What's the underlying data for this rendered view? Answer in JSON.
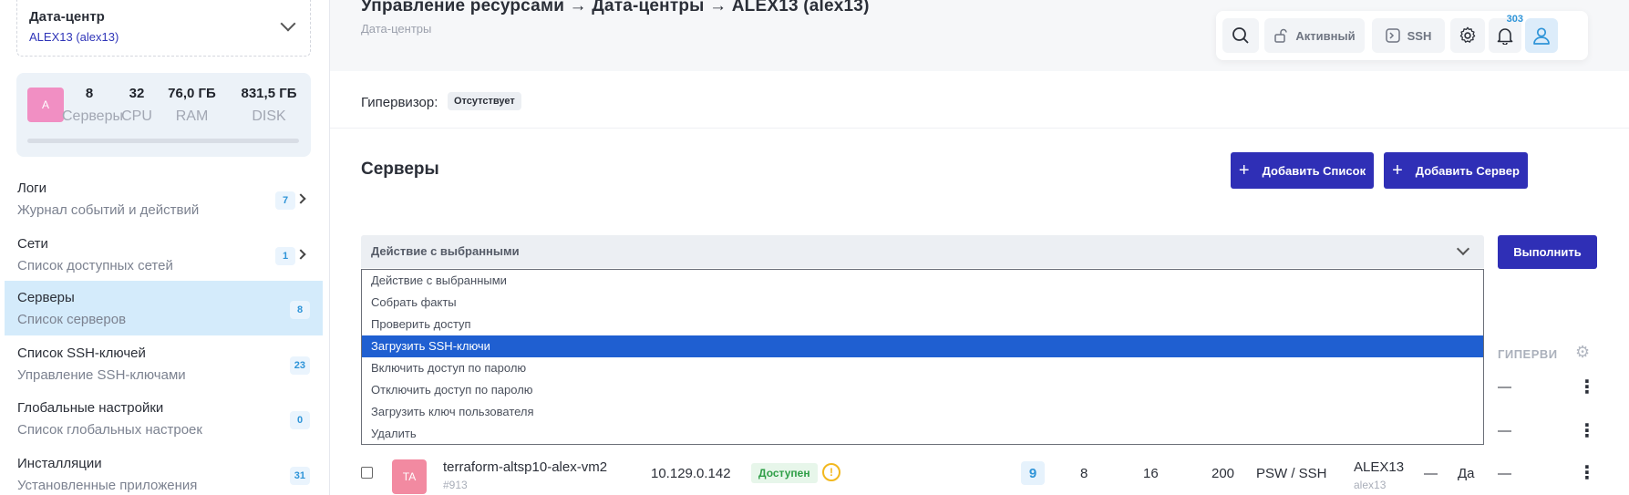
{
  "sidebar": {
    "datacenter_label": "Дата-центр",
    "datacenter_value": "ALEX13 (alex13)",
    "avatar_letter": "A",
    "stats": [
      {
        "num": "8",
        "label": "Серверы"
      },
      {
        "num": "32",
        "label": "CPU"
      },
      {
        "num": "76,0 ГБ",
        "label": "RAM"
      },
      {
        "num": "831,5 ГБ",
        "label": "DISK"
      }
    ],
    "items": [
      {
        "title": "Логи",
        "sub": "Журнал событий и действий",
        "badge": "7"
      },
      {
        "title": "Сети",
        "sub": "Список доступных сетей",
        "badge": "1"
      },
      {
        "title": "Серверы",
        "sub": "Список серверов",
        "badge": "8"
      },
      {
        "title": "Список SSH-ключей",
        "sub": "Управление SSH-ключами",
        "badge": "23"
      },
      {
        "title": "Глобальные настройки",
        "sub": "Список глобальных настроек",
        "badge": "0"
      },
      {
        "title": "Инсталляции",
        "sub": "Установленные приложения",
        "badge": "31"
      }
    ]
  },
  "header": {
    "breadcrumb": "Управление ресурсами → Дата-центры → ALEX13 (alex13)",
    "breadcrumb_sub": "Дата-центры"
  },
  "topbar": {
    "active_label": "Активный",
    "ssh_label": "SSH",
    "notif_count": "303"
  },
  "hypervisor": {
    "label": "Гипервизор:",
    "value": "Отсутствует"
  },
  "servers": {
    "title": "Серверы",
    "add_list": "Добавить Список",
    "add_server": "Добавить Сервер",
    "select_value": "Действие с выбранными",
    "execute": "Выполнить",
    "options": [
      "Действие с выбранными",
      "Собрать факты",
      "Проверить доступ",
      "Загрузить SSH-ключи",
      "Включить доступ по паролю",
      "Отключить доступ по паролю",
      "Загрузить ключ пользователя",
      "Удалить"
    ],
    "selected_option_index": 3,
    "column_header": "ГИПЕРВИ",
    "dash": "—",
    "row": {
      "avatar": "TA",
      "name": "terraform-altsp10-alex-vm2",
      "id": "#913",
      "ip": "10.129.0.142",
      "status": "Доступен",
      "warn": "!",
      "count": "9",
      "cpu": "8",
      "ram": "16",
      "disk": "200",
      "access": "PSW / SSH",
      "dc": "ALEX13",
      "dc_sub": "alex13",
      "dash": "—",
      "yes": "Да"
    }
  },
  "colors": {
    "primary": "#2f2fb6",
    "selected": "#1f5fd1",
    "badge_blue": "#2e94d8",
    "success": "#2f9e47",
    "warning": "#f2b81e"
  }
}
